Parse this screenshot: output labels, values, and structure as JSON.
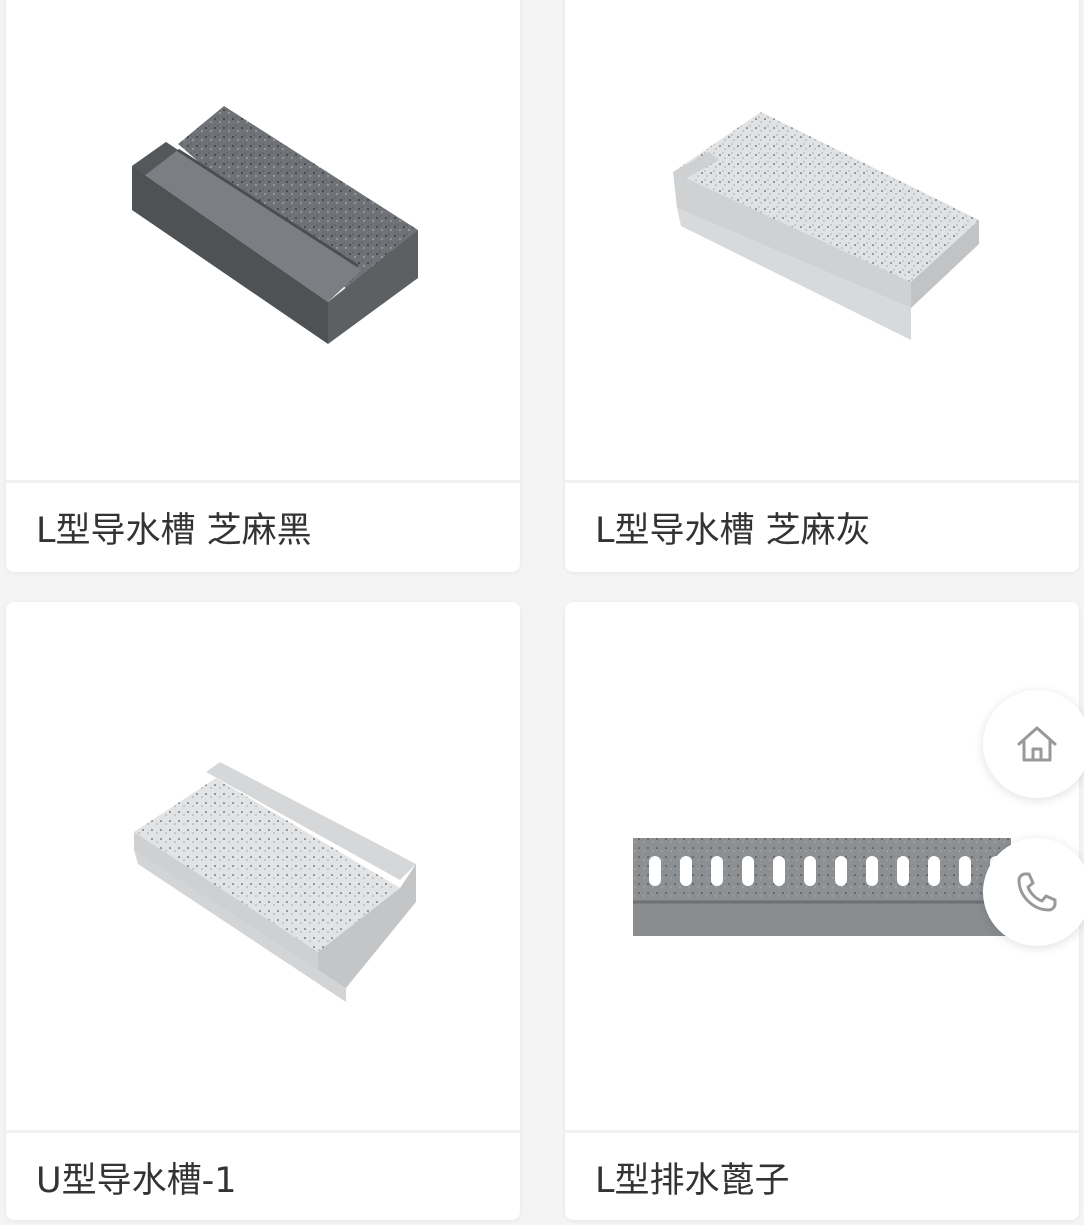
{
  "products": [
    {
      "title": "L型导水槽 芝麻黑",
      "image": "dark-gray-l-channel-stone"
    },
    {
      "title": "L型导水槽 芝麻灰",
      "image": "light-gray-l-channel-stone"
    },
    {
      "title": "U型导水槽-1",
      "image": "light-gray-u-channel-stone"
    },
    {
      "title": "L型排水蓖子",
      "image": "gray-drain-grate-stone"
    }
  ],
  "floating_actions": [
    {
      "icon": "home-icon"
    },
    {
      "icon": "phone-icon"
    }
  ],
  "colors": {
    "page_background": "#f4f4f4",
    "card_background": "#ffffff",
    "title_text": "#333333",
    "icon_stroke": "#999999"
  }
}
